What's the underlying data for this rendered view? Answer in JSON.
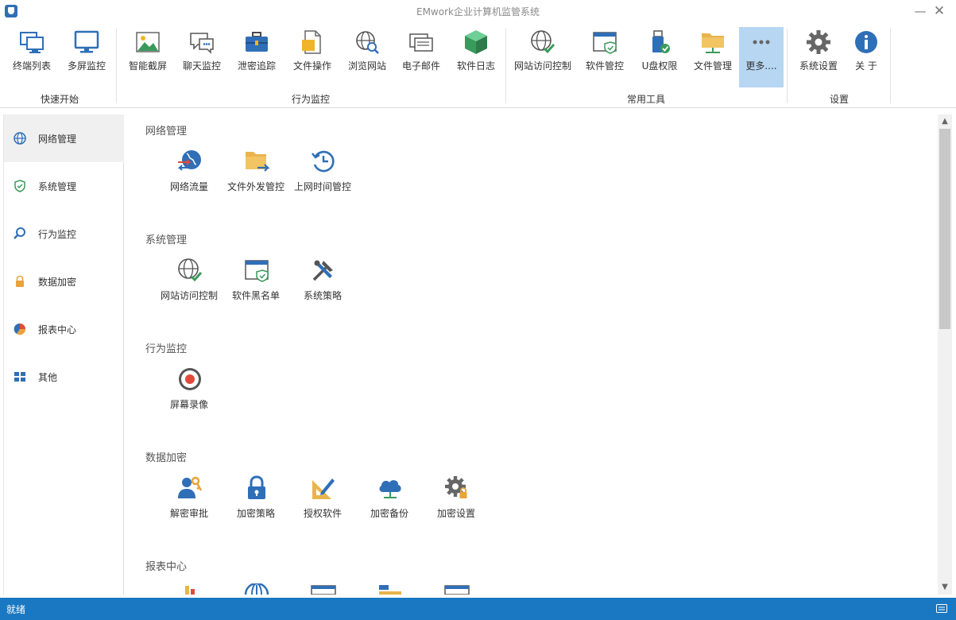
{
  "window": {
    "title": "EMwork企业计算机监管系统",
    "minimize": "—",
    "close": "✕"
  },
  "ribbon": {
    "groups": [
      "快速开始",
      "行为监控",
      "常用工具",
      "设置"
    ],
    "buttons": [
      {
        "label": "终端列表",
        "icon": "terminal-list-icon"
      },
      {
        "label": "多屏监控",
        "icon": "monitor-icon"
      },
      {
        "label": "智能截屏",
        "icon": "screenshot-icon"
      },
      {
        "label": "聊天监控",
        "icon": "chat-icon"
      },
      {
        "label": "泄密追踪",
        "icon": "briefcase-icon"
      },
      {
        "label": "文件操作",
        "icon": "file-icon"
      },
      {
        "label": "浏览网站",
        "icon": "web-search-icon"
      },
      {
        "label": "电子邮件",
        "icon": "email-icon"
      },
      {
        "label": "软件日志",
        "icon": "cube-icon"
      },
      {
        "label": "网站访问控制",
        "icon": "globe-check-icon"
      },
      {
        "label": "软件管控",
        "icon": "window-shield-icon"
      },
      {
        "label": "U盘权限",
        "icon": "usb-icon"
      },
      {
        "label": "文件管理",
        "icon": "folder-network-icon"
      },
      {
        "label": "更多....",
        "icon": "more-icon"
      },
      {
        "label": "系统设置",
        "icon": "gear-icon"
      },
      {
        "label": "关 于",
        "icon": "info-icon"
      }
    ]
  },
  "sidebar": {
    "items": [
      {
        "label": "网络管理",
        "icon": "globe-icon"
      },
      {
        "label": "系统管理",
        "icon": "shield-icon"
      },
      {
        "label": "行为监控",
        "icon": "magnifier-icon"
      },
      {
        "label": "数据加密",
        "icon": "lock-icon"
      },
      {
        "label": "报表中心",
        "icon": "pie-chart-icon"
      },
      {
        "label": "其他",
        "icon": "grid-icon"
      }
    ]
  },
  "sections": [
    {
      "title": "网络管理",
      "tiles": [
        {
          "label": "网络流量",
          "icon": "network-traffic-icon"
        },
        {
          "label": "文件外发管控",
          "icon": "folder-send-icon"
        },
        {
          "label": "上网时间管控",
          "icon": "clock-history-icon"
        }
      ]
    },
    {
      "title": "系统管理",
      "tiles": [
        {
          "label": "网站访问控制",
          "icon": "globe-check-icon"
        },
        {
          "label": "软件黑名单",
          "icon": "window-shield-icon"
        },
        {
          "label": "系统策略",
          "icon": "tools-icon"
        }
      ]
    },
    {
      "title": "行为监控",
      "tiles": [
        {
          "label": "屏幕录像",
          "icon": "record-icon"
        }
      ]
    },
    {
      "title": "数据加密",
      "tiles": [
        {
          "label": "解密审批",
          "icon": "user-key-icon"
        },
        {
          "label": "加密策略",
          "icon": "lock-icon"
        },
        {
          "label": "授权软件",
          "icon": "ruler-pen-icon"
        },
        {
          "label": "加密备份",
          "icon": "cloud-icon"
        },
        {
          "label": "加密设置",
          "icon": "gear-lock-icon"
        }
      ]
    },
    {
      "title": "报表中心",
      "tiles": []
    }
  ],
  "status": {
    "text": "就绪"
  },
  "colors": {
    "accent": "#1a78c2",
    "active_ribbon": "#b7d6f2",
    "nav_active": "#f0f0f0"
  }
}
